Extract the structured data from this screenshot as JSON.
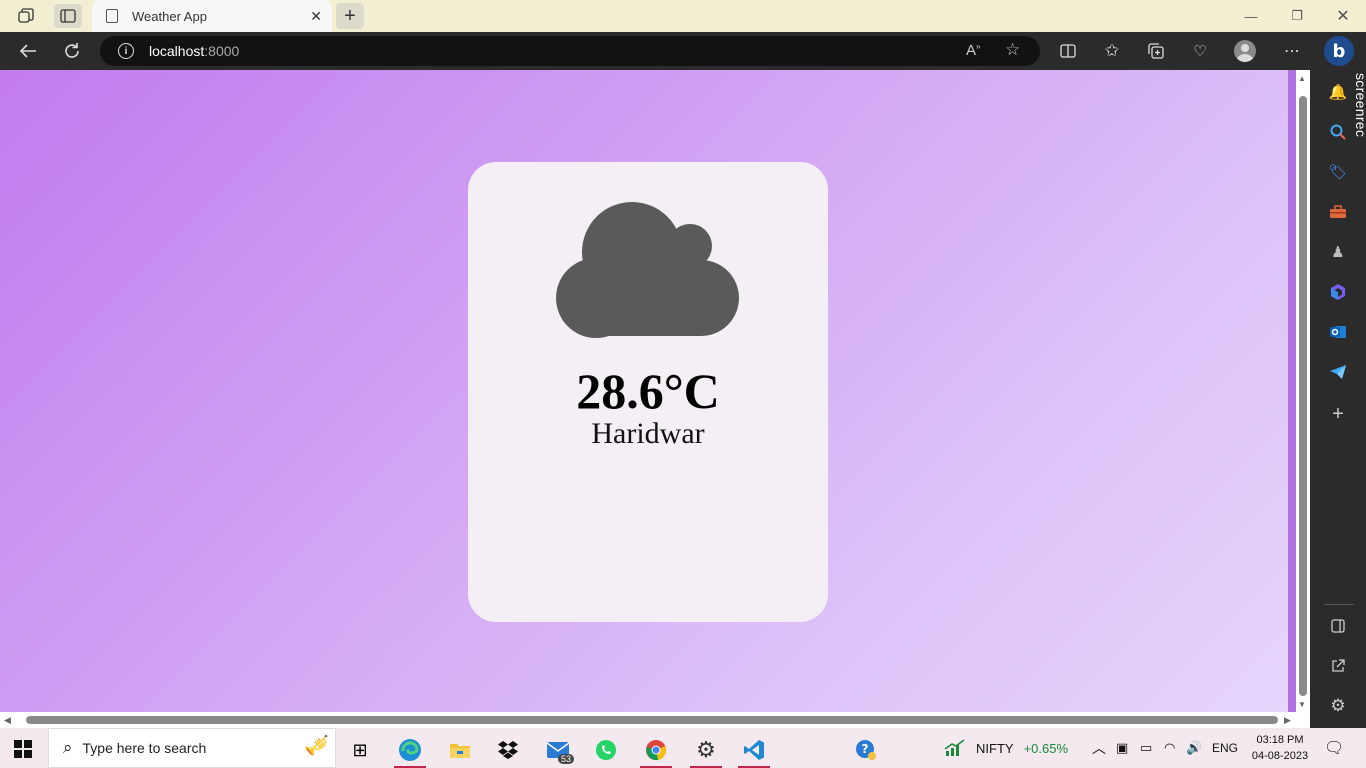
{
  "browser": {
    "tab_title": "Weather App",
    "url_host": "localhost",
    "url_port": ":8000"
  },
  "weather": {
    "icon": "cloud-icon",
    "temperature": "28.6°C",
    "city": "Haridwar"
  },
  "sidebar": {
    "screenrec_label": "screenrec",
    "icons": [
      "bell-icon",
      "search-icon",
      "shopping-tag-icon",
      "toolbox-icon",
      "games-icon",
      "microsoft-365-icon",
      "outlook-icon",
      "telegram-icon",
      "add-icon",
      "sidebar-panel-icon",
      "external-link-icon",
      "settings-icon"
    ]
  },
  "taskbar": {
    "search_placeholder": "Type here to search",
    "mail_badge": "53",
    "nifty_label": "NIFTY",
    "nifty_change": "+0.65%",
    "language": "ENG",
    "time": "03:18 PM",
    "date": "04-08-2023"
  },
  "colors": {
    "background_start": "#c17bee",
    "background_end": "#e6d6fb",
    "card": "#f4eff5",
    "cloud": "#5a5a5a"
  }
}
